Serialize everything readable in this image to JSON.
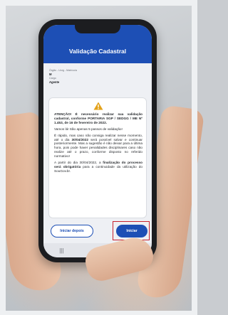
{
  "app": {
    "title": "Validação Cadastral"
  },
  "user_info": {
    "org_label": "Órgão - Uorg - Matrícula",
    "org_value": "M",
    "role_label": "Cargo",
    "role_value": "Agente"
  },
  "notice": {
    "icon": "warning-icon",
    "paragraph1_prefix": "ATENÇÃO! É necessário realizar sua validação cadastral, conforme ",
    "paragraph1_bold": "PORTARIA SGP / SEDGG / ME Nº 1.453, de 16 de fevereiro de 2022.",
    "paragraph2": "Vamos lá! São apenas 5 passos de validação!",
    "paragraph3_prefix": "É rápido, mas caso não consiga realizar nesse momento, até o dia ",
    "paragraph3_date": "30/04/2022",
    "paragraph3_suffix": " será possível salvar e continuar posteriormente. Mas a sugestão é não deixar para a última hora, pois pode haver penalidades disciplinares caso não realize até o prazo, conforme disposto no referido normativo!",
    "paragraph4_prefix": "A partir do dia 30/04/2022, a ",
    "paragraph4_bold": "finalização do processo será obrigatória",
    "paragraph4_suffix": " para a continuidade da utilização do SouGov.br."
  },
  "actions": {
    "later_label": "Iniciar depois",
    "start_label": "Iniciar"
  },
  "nav": {
    "recent": "|||",
    "home": "○",
    "back": "‹"
  },
  "colors": {
    "brand_blue": "#1d4fb5",
    "highlight_red": "#c8232f",
    "warning_amber": "#e3a21a"
  }
}
